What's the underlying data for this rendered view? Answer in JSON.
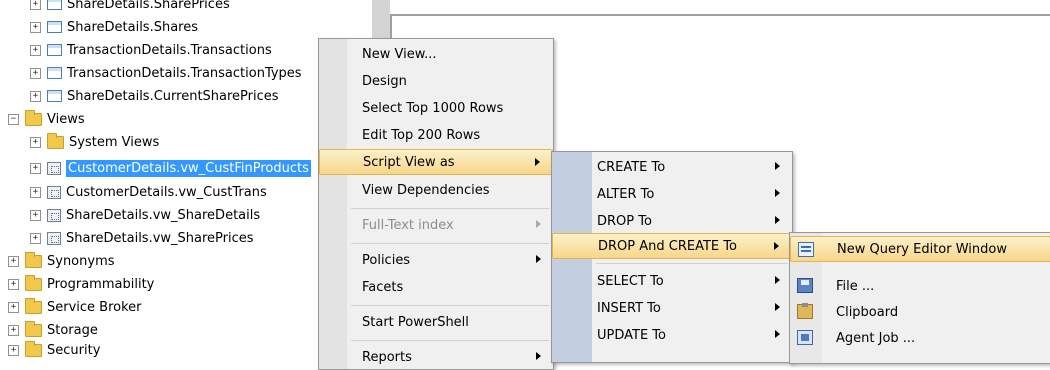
{
  "tree": {
    "rows": [
      {
        "label": "ShareDetails.SharePrices",
        "type": "table",
        "expander": "+"
      },
      {
        "label": "ShareDetails.Shares",
        "type": "table",
        "expander": "+"
      },
      {
        "label": "TransactionDetails.Transactions",
        "type": "table",
        "expander": "+"
      },
      {
        "label": "TransactionDetails.TransactionTypes",
        "type": "table",
        "expander": "+"
      },
      {
        "label": "ShareDetails.CurrentSharePrices",
        "type": "table",
        "expander": "+"
      },
      {
        "label": "Views",
        "type": "folder",
        "expander": "−"
      },
      {
        "label": "System Views",
        "type": "folder",
        "expander": "+"
      },
      {
        "label": "CustomerDetails.vw_CustFinProducts",
        "type": "view",
        "expander": "+",
        "selected": true
      },
      {
        "label": "CustomerDetails.vw_CustTrans",
        "type": "view",
        "expander": "+"
      },
      {
        "label": "ShareDetails.vw_ShareDetails",
        "type": "view",
        "expander": "+"
      },
      {
        "label": "ShareDetails.vw_SharePrices",
        "type": "view",
        "expander": "+"
      },
      {
        "label": "Synonyms",
        "type": "folder",
        "expander": "+"
      },
      {
        "label": "Programmability",
        "type": "folder",
        "expander": "+"
      },
      {
        "label": "Service Broker",
        "type": "folder",
        "expander": "+"
      },
      {
        "label": "Storage",
        "type": "folder",
        "expander": "+"
      },
      {
        "label": "Security",
        "type": "folder",
        "expander": "+"
      }
    ]
  },
  "context_menu": {
    "items": [
      {
        "label": "New View..."
      },
      {
        "label": "Design"
      },
      {
        "label": "Select Top 1000 Rows"
      },
      {
        "label": "Edit Top 200 Rows"
      },
      {
        "label": "Script View as",
        "submenu": true,
        "highlighted": true
      },
      {
        "label": "View Dependencies"
      },
      {
        "label": "Full-Text index",
        "submenu": true,
        "disabled": true
      },
      {
        "label": "Policies",
        "submenu": true
      },
      {
        "label": "Facets"
      },
      {
        "label": "Start PowerShell"
      },
      {
        "label": "Reports",
        "submenu": true
      }
    ]
  },
  "script_menu": {
    "items": [
      {
        "label": "CREATE To"
      },
      {
        "label": "ALTER To"
      },
      {
        "label": "DROP To"
      },
      {
        "label": "DROP And CREATE To",
        "highlighted": true
      },
      {
        "label": "SELECT To"
      },
      {
        "label": "INSERT To"
      },
      {
        "label": "UPDATE To"
      }
    ]
  },
  "target_menu": {
    "items": [
      {
        "label": "New Query Editor Window",
        "icon": "query-window-icon",
        "highlighted": true
      },
      {
        "label": "File ...",
        "icon": "save-file-icon"
      },
      {
        "label": "Clipboard",
        "icon": "clipboard-icon"
      },
      {
        "label": "Agent Job ...",
        "icon": "agent-job-icon"
      }
    ]
  }
}
